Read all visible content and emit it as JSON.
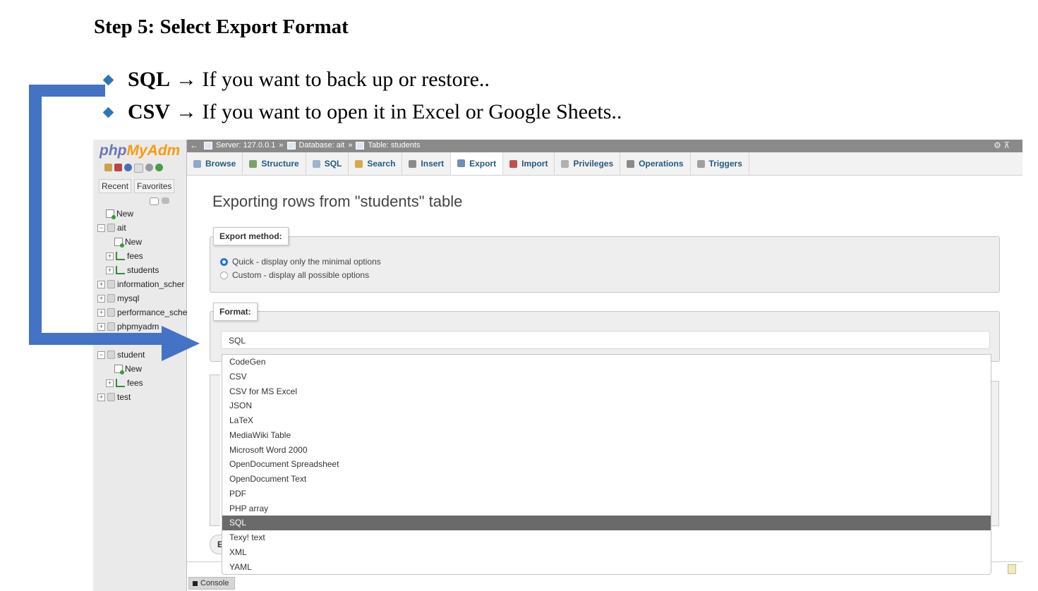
{
  "doc": {
    "title": "Step 5: Select Export Format",
    "bullets": [
      {
        "term": "SQL",
        "text": "→ If you want to back up or restore.."
      },
      {
        "term": "CSV",
        "text": "→ If you want to open it in Excel or Google Sheets.."
      }
    ]
  },
  "sidebar": {
    "logo_php": "php",
    "logo_rest": "MyAdm",
    "tabs": [
      "Recent",
      "Favorites"
    ],
    "tree": [
      {
        "label": "New",
        "level": 1,
        "icon": "new"
      },
      {
        "label": "ait",
        "level": 0,
        "icon": "db",
        "toggle": "−"
      },
      {
        "label": "New",
        "level": 2,
        "icon": "new"
      },
      {
        "label": "fees",
        "level": 1,
        "icon": "table",
        "toggle": "+"
      },
      {
        "label": "students",
        "level": 1,
        "icon": "table",
        "toggle": "+"
      },
      {
        "label": "information_scher",
        "level": 0,
        "icon": "db",
        "toggle": "+"
      },
      {
        "label": "mysql",
        "level": 0,
        "icon": "db",
        "toggle": "+"
      },
      {
        "label": "performance_sche",
        "level": 0,
        "icon": "db",
        "toggle": "+"
      },
      {
        "label": "phpmyadm",
        "level": 0,
        "icon": "db",
        "toggle": "+"
      },
      {
        "label": "",
        "level": 0,
        "icon": "none"
      },
      {
        "label": "student",
        "level": 0,
        "icon": "db",
        "toggle": "−"
      },
      {
        "label": "New",
        "level": 2,
        "icon": "new"
      },
      {
        "label": "fees",
        "level": 1,
        "icon": "table",
        "toggle": "+"
      },
      {
        "label": "test",
        "level": 0,
        "icon": "db",
        "toggle": "+"
      }
    ]
  },
  "breadcrumb": {
    "server": "Server: 127.0.0.1",
    "database": "Database: ait",
    "table": "Table: students",
    "sep": "»"
  },
  "tabs": [
    {
      "label": "Browse",
      "icon": "browse-icon",
      "color": "#8fa8c8"
    },
    {
      "label": "Structure",
      "icon": "structure-icon",
      "color": "#7aa36b"
    },
    {
      "label": "SQL",
      "icon": "sql-icon",
      "color": "#9fb3cc"
    },
    {
      "label": "Search",
      "icon": "search-icon",
      "color": "#d8a84a"
    },
    {
      "label": "Insert",
      "icon": "insert-icon",
      "color": "#8a8a8a"
    },
    {
      "label": "Export",
      "icon": "export-icon",
      "color": "#6f8fb5",
      "active": true
    },
    {
      "label": "Import",
      "icon": "import-icon",
      "color": "#c05050"
    },
    {
      "label": "Privileges",
      "icon": "privileges-icon",
      "color": "#b0b0b0"
    },
    {
      "label": "Operations",
      "icon": "operations-icon",
      "color": "#8a8a8a"
    },
    {
      "label": "Triggers",
      "icon": "triggers-icon",
      "color": "#a0a0a0"
    }
  ],
  "main": {
    "heading": "Exporting rows from \"students\" table",
    "export_method": {
      "legend": "Export method:",
      "options": [
        {
          "label": "Quick - display only the minimal options",
          "checked": true
        },
        {
          "label": "Custom - display all possible options",
          "checked": false
        }
      ]
    },
    "format": {
      "legend": "Format:",
      "selected": "SQL",
      "options": [
        "CodeGen",
        "CSV",
        "CSV for MS Excel",
        "JSON",
        "LaTeX",
        "MediaWiki Table",
        "Microsoft Word 2000",
        "OpenDocument Spreadsheet",
        "OpenDocument Text",
        "PDF",
        "PHP array",
        "SQL",
        "Texy! text",
        "XML",
        "YAML"
      ]
    },
    "partial_button_text": "E"
  },
  "console": {
    "label": "Console"
  },
  "colors": {
    "accent_arrow": "#4472c4",
    "bullet": "#2e75b6",
    "selected_option": "#6a6a6a"
  }
}
